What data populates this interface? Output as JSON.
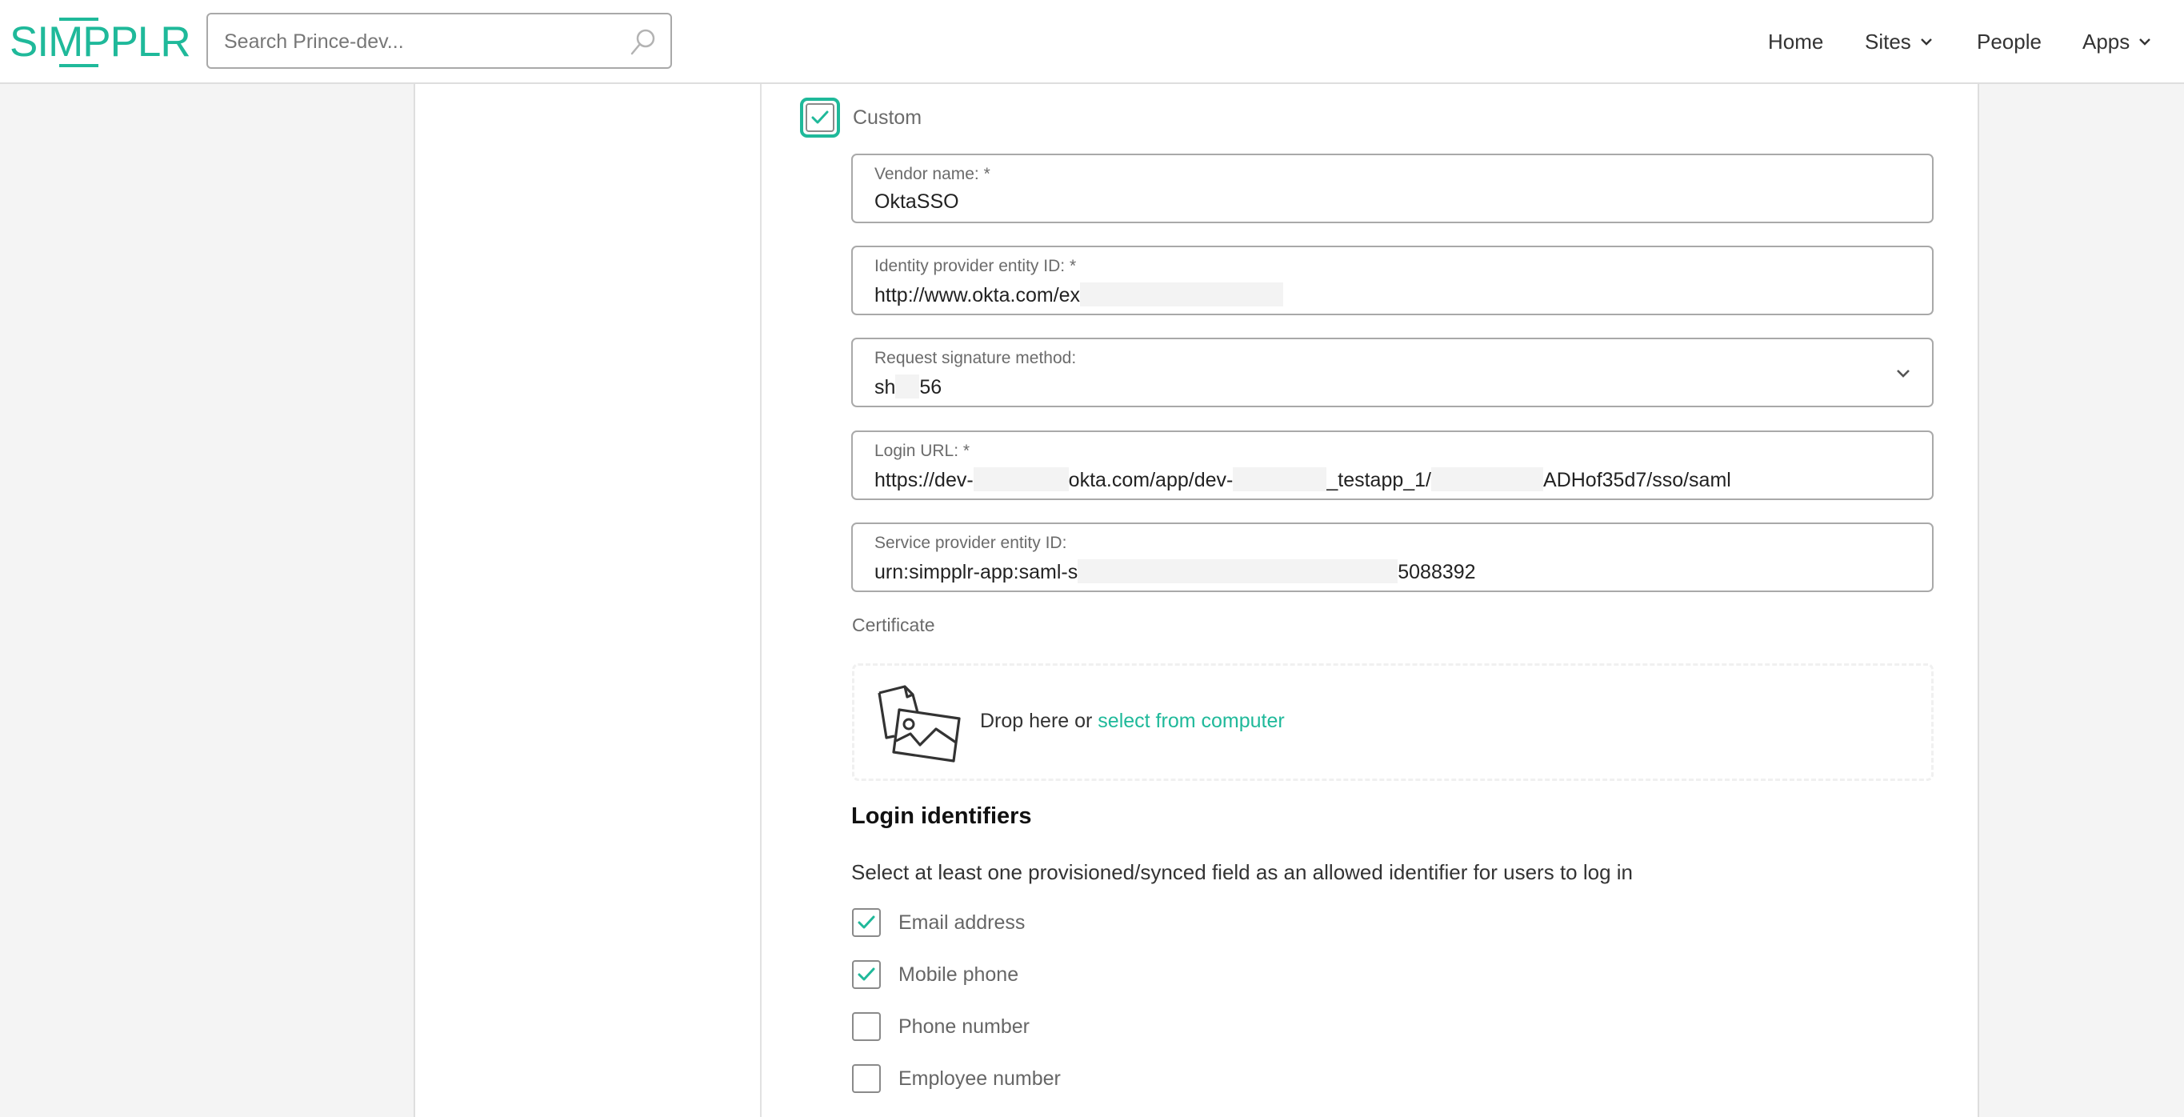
{
  "header": {
    "logo": "SIMPPLR",
    "search": {
      "placeholder": "Search Prince-dev...",
      "value": ""
    },
    "nav": [
      {
        "label": "Home",
        "has_dropdown": false
      },
      {
        "label": "Sites",
        "has_dropdown": true
      },
      {
        "label": "People",
        "has_dropdown": false
      },
      {
        "label": "Apps",
        "has_dropdown": true
      }
    ]
  },
  "form": {
    "custom": {
      "label": "Custom",
      "checked": true
    },
    "fields": {
      "vendor_name": {
        "label": "Vendor name: *",
        "value": "OktaSSO"
      },
      "idp_entity_id": {
        "label": "Identity provider entity ID: *",
        "value_prefix": "http://www.okta.com/ex",
        "value_suffix": ""
      },
      "signature_method": {
        "label": "Request signature method:",
        "value_prefix": "sh",
        "value_suffix": "56"
      },
      "login_url": {
        "label": "Login URL: *",
        "parts": [
          "https://dev-",
          "okta.com/app/dev-",
          "_testapp_1/",
          "ADHof35d7/sso/saml"
        ]
      },
      "sp_entity_id": {
        "label": "Service provider entity ID:",
        "value_prefix": "urn:simpplr-app:saml-s",
        "value_suffix": "5088392"
      }
    },
    "certificate": {
      "label": "Certificate",
      "drop_text": "Drop here or ",
      "link_text": "select from computer"
    },
    "login_identifiers": {
      "title": "Login identifiers",
      "description": "Select at least one provisioned/synced field as an allowed identifier for users to log in",
      "options": [
        {
          "label": "Email address",
          "checked": true
        },
        {
          "label": "Mobile phone",
          "checked": true
        },
        {
          "label": "Phone number",
          "checked": false
        },
        {
          "label": "Employee number",
          "checked": false
        }
      ]
    }
  },
  "colors": {
    "accent": "#1fb99a",
    "border": "#a9a9a9",
    "background": "#f4f4f4"
  }
}
